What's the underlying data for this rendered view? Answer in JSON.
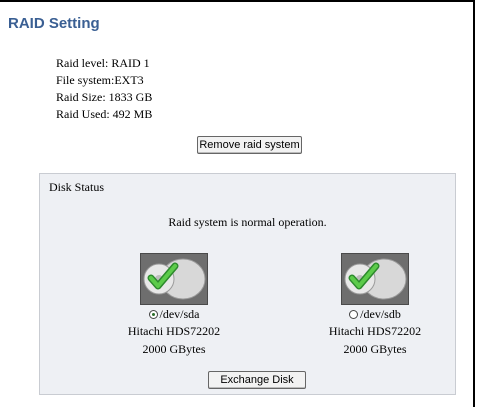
{
  "page": {
    "title": "RAID Setting"
  },
  "raid_info": {
    "level": "Raid level:  RAID 1",
    "file_system": "File system:EXT3",
    "size": "Raid Size:   1833 GB",
    "used": "Raid Used: 492 MB"
  },
  "buttons": {
    "remove": "Remove raid system",
    "exchange": "Exchange Disk"
  },
  "disk_status": {
    "title": "Disk Status",
    "message": "Raid system is normal operation.",
    "disks": [
      {
        "device": "/dev/sda",
        "model": "Hitachi HDS72202",
        "capacity": "2000 GBytes",
        "selected": true
      },
      {
        "device": "/dev/sdb",
        "model": "Hitachi HDS72202",
        "capacity": "2000 GBytes",
        "selected": false
      }
    ]
  },
  "colors": {
    "title": "#3a5f93",
    "panel_bg": "#eef0f4",
    "check": "#3aa53a"
  }
}
